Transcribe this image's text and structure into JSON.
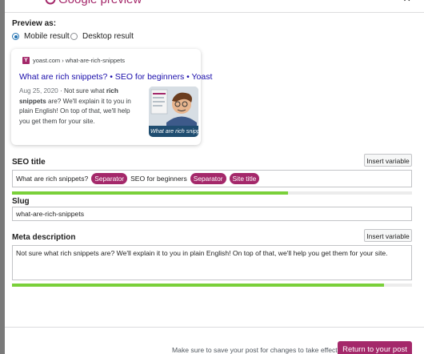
{
  "modal": {
    "title": "Google preview",
    "close_glyph": "×"
  },
  "preview": {
    "label": "Preview as:",
    "options": [
      {
        "label": "Mobile result",
        "selected": true
      },
      {
        "label": "Desktop result",
        "selected": false
      }
    ]
  },
  "serp": {
    "favicon_letter": "Y",
    "url": "yoast.com › what-are-rich-snippets",
    "title": "What are rich snippets? • SEO for beginners • Yoast",
    "date": "Aug 25, 2020",
    "separator": "·",
    "snippet_before": "Not sure what",
    "snippet_bold": "rich snippets",
    "snippet_after": "are? We'll explain it to you in plain English! On top of that, we'll help you get them for your site.",
    "thumbnail_caption": "What are rich snipp",
    "icon": "yoast-favicon-icon"
  },
  "seo_title": {
    "label": "SEO title",
    "insert_variable": "Insert variable",
    "text": "What are rich snippets?",
    "pill_1": "Separator",
    "text_2": "SEO for beginners",
    "pill_2": "Separator",
    "pill_3": "Site title",
    "progress": 0.69
  },
  "slug": {
    "label": "Slug",
    "value": "what-are-rich-snippets"
  },
  "meta_description": {
    "label": "Meta description",
    "insert_variable": "Insert variable",
    "value": "Not sure what rich snippets are? We'll explain it to you in plain English! On top of that, we'll help you get them for your site.",
    "progress": 0.93
  },
  "footer": {
    "hint": "Make sure to save your post for changes to take effect",
    "return_button": "Return to your post"
  },
  "colors": {
    "brand": "#a4286a",
    "link": "#1a0dab",
    "progress_good": "#7ad03a",
    "radio_accent": "#2271b1"
  }
}
